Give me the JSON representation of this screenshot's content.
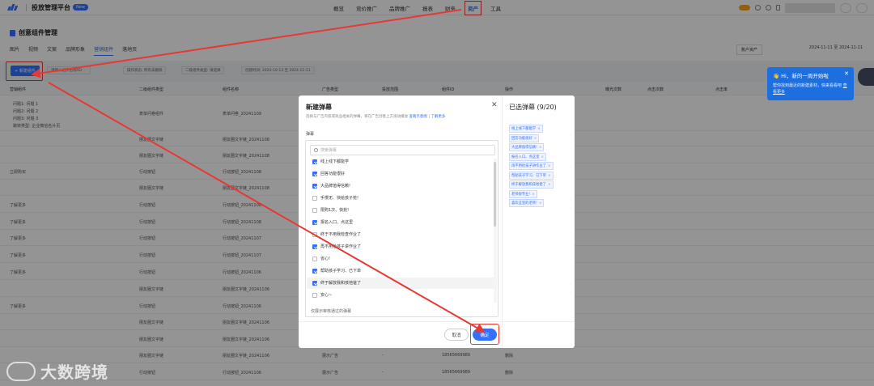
{
  "header": {
    "platform": "投放管理平台",
    "badge": "New",
    "nav": [
      "概览",
      "竞价推广",
      "品牌推广",
      "报表",
      "财务",
      "资产",
      "工具"
    ],
    "active_nav": "资产"
  },
  "page": {
    "title": "创意组件管理",
    "subtabs": [
      "图片",
      "视频",
      "文案",
      "品牌形象",
      "营销组件",
      "落地页"
    ],
    "active_subtab": "营销组件",
    "account_select": "账户资产",
    "date_range": "2024-11-11 至 2024-11-11"
  },
  "filters": {
    "create_button": "+ 新建组件",
    "search_placeholder": "请输入组件名称/ID",
    "chips": [
      "操作状态: 所有未删除",
      "二级组件类型: 请选择",
      "创建时间: 2024-10-13 至 2024-11-11"
    ]
  },
  "table": {
    "columns": [
      "营销组件",
      "二级组件类型",
      "组件名称",
      "广告类型",
      "投放范围",
      "组件ID",
      "操作",
      "曝光次数",
      "点击次数",
      "点击率",
      "转化数"
    ],
    "rows": [
      {
        "c1": "问题1: 问题 1\n问题2: 问题 2\n问题3: 问题 3\n跳转类型: 企业微信名片页",
        "c2": "表单问卷组件",
        "c3": "表单问卷_20241109",
        "c4": "",
        "c5": "",
        "c6": "",
        "c7": ""
      },
      {
        "c1": "",
        "c2": "朋友圈文字链",
        "c3": "朋友圈文字链_20241108",
        "c4": "",
        "c5": "",
        "c6": "",
        "c7": ""
      },
      {
        "c1": "",
        "c2": "朋友圈文字链",
        "c3": "朋友圈文字链_20241108",
        "c4": "",
        "c5": "",
        "c6": "",
        "c7": ""
      },
      {
        "c1": "立即购买",
        "c2": "行动按钮",
        "c3": "行动按钮_20241108",
        "c4": "",
        "c5": "",
        "c6": "",
        "c7": ""
      },
      {
        "c1": "",
        "c2": "朋友圈文字链",
        "c3": "朋友圈文字链_20241108",
        "c4": "",
        "c5": "",
        "c6": "",
        "c7": ""
      },
      {
        "c1": "了解更多",
        "c2": "行动按钮",
        "c3": "行动按钮_20241108",
        "c4": "",
        "c5": "",
        "c6": "",
        "c7": ""
      },
      {
        "c1": "了解更多",
        "c2": "行动按钮",
        "c3": "行动按钮_20241108",
        "c4": "",
        "c5": "",
        "c6": "",
        "c7": ""
      },
      {
        "c1": "了解更多",
        "c2": "行动按钮",
        "c3": "行动按钮_20241107",
        "c4": "",
        "c5": "",
        "c6": "",
        "c7": ""
      },
      {
        "c1": "了解更多",
        "c2": "行动按钮",
        "c3": "行动按钮_20241107",
        "c4": "",
        "c5": "",
        "c6": "",
        "c7": ""
      },
      {
        "c1": "了解更多",
        "c2": "行动按钮",
        "c3": "行动按钮_20241106",
        "c4": "",
        "c5": "",
        "c6": "",
        "c7": ""
      },
      {
        "c1": "",
        "c2": "朋友圈文字链",
        "c3": "朋友圈文字链_20241106",
        "c4": "",
        "c5": "",
        "c6": "",
        "c7": ""
      },
      {
        "c1": "了解更多",
        "c2": "行动按钮",
        "c3": "行动按钮_20241106",
        "c4": "",
        "c5": "",
        "c6": "",
        "c7": ""
      },
      {
        "c1": "",
        "c2": "朋友圈文字链",
        "c3": "朋友圈文字链_20241106",
        "c4": "",
        "c5": "",
        "c6": "",
        "c7": ""
      },
      {
        "c1": "",
        "c2": "朋友圈文字链",
        "c3": "朋友圈文字链_20241106",
        "c4": "",
        "c5": "",
        "c6": "",
        "c7": ""
      },
      {
        "c1": "",
        "c2": "朋友圈文字链",
        "c3": "朋友圈文字链_20241106",
        "c4": "展示广告",
        "c5": "-",
        "c6": "18565669989",
        "c7": "删除"
      },
      {
        "c1": "",
        "c2": "行动按钮",
        "c3": "行动按钮_20241106",
        "c4": "展示广告",
        "c5": "-",
        "c6": "18565669989",
        "c7": "删除"
      },
      {
        "c1": "",
        "c2": "行动按钮",
        "c3": "行动按钮_20241106",
        "c4": "展示广告",
        "c5": "-",
        "c6": "18565669989",
        "c7": "删除"
      }
    ]
  },
  "modal": {
    "title": "新建弹幕",
    "desc": "选择与广告内容或商品相关的弹幕，将在广告创意上方滚动播放",
    "desc_link1": "查看示意图",
    "desc_link2": "了解更多",
    "section_label": "弹幕",
    "search_placeholder": "搜索弹幕",
    "items": [
      {
        "label": "线上线下都能学",
        "checked": true
      },
      {
        "label": "回答功能很好",
        "checked": true
      },
      {
        "label": "大品牌值得信赖!",
        "checked": true
      },
      {
        "label": "手慢无、快给孩子抢!",
        "checked": false
      },
      {
        "label": "限购1次、快抢!",
        "checked": false
      },
      {
        "label": "报名入口、点这里",
        "checked": true
      },
      {
        "label": "终于不用我检查作业了",
        "checked": false
      },
      {
        "label": "再不用给孩子讲作业了",
        "checked": true
      },
      {
        "label": "省心!",
        "checked": false
      },
      {
        "label": "帮助孩子学习、已下单",
        "checked": true
      },
      {
        "label": "终于解放我和孩他爸了",
        "checked": true
      },
      {
        "label": "安心~",
        "checked": false
      }
    ],
    "footnote": "仅展示审核通过的弹幕",
    "selected_title": "已选弹幕 (9/20)",
    "selected": [
      "线上线下都能学",
      "回答功能很好",
      "大品牌值得信赖!",
      "报名入口、点这里",
      "再不用给孩子讲作业了",
      "帮助孩子学习、已下单",
      "终于解放我和孩他爸了",
      "老师很专业!",
      "喜欢这里的老师!"
    ],
    "cancel": "取消",
    "ok": "确定"
  },
  "tooltip": {
    "title": "Hi，新的一周开始啦",
    "body": "帮你找到最近的新建素材，快来看看吧",
    "link": "查看更多"
  },
  "watermark": "大数跨境",
  "colors": {
    "accent": "#3370ff",
    "annotation_red": "#e53935"
  }
}
